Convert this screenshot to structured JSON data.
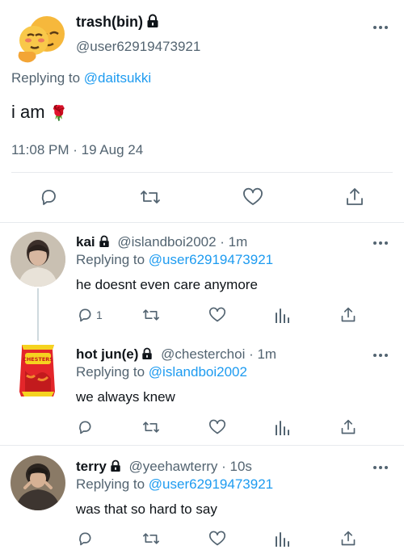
{
  "main_tweet": {
    "display_name": "trash(bin)",
    "handle": "@user62919473921",
    "replying_label": "Replying to ",
    "replying_to": "@daitsukki",
    "text": "i am",
    "emoji": "🌹",
    "timestamp": "11:08 PM · 19 Aug 24",
    "avatar_icon": "emoji-face-icon"
  },
  "replies": [
    {
      "display_name": "kai",
      "handle": "@islandboi2002",
      "time": "· 1m",
      "replying_label": "Replying to ",
      "replying_to": "@user62919473921",
      "text": "he doesnt even care anymore",
      "reply_count": "1"
    },
    {
      "display_name": "hot jun(e)",
      "handle": "@chesterchoi",
      "time": "· 1m",
      "replying_label": "Replying to ",
      "replying_to": "@islandboi2002",
      "text": "we always knew",
      "avatar_text": "CHESTERS"
    },
    {
      "display_name": "terry",
      "handle": "@yeehawterry",
      "time": "· 10s",
      "replying_label": "Replying to ",
      "replying_to": "@user62919473921",
      "text": "was that so hard to say"
    }
  ],
  "colors": {
    "link": "#1d9bf0",
    "muted": "#536471",
    "divider": "#e7eaee",
    "text": "#0f1419"
  }
}
